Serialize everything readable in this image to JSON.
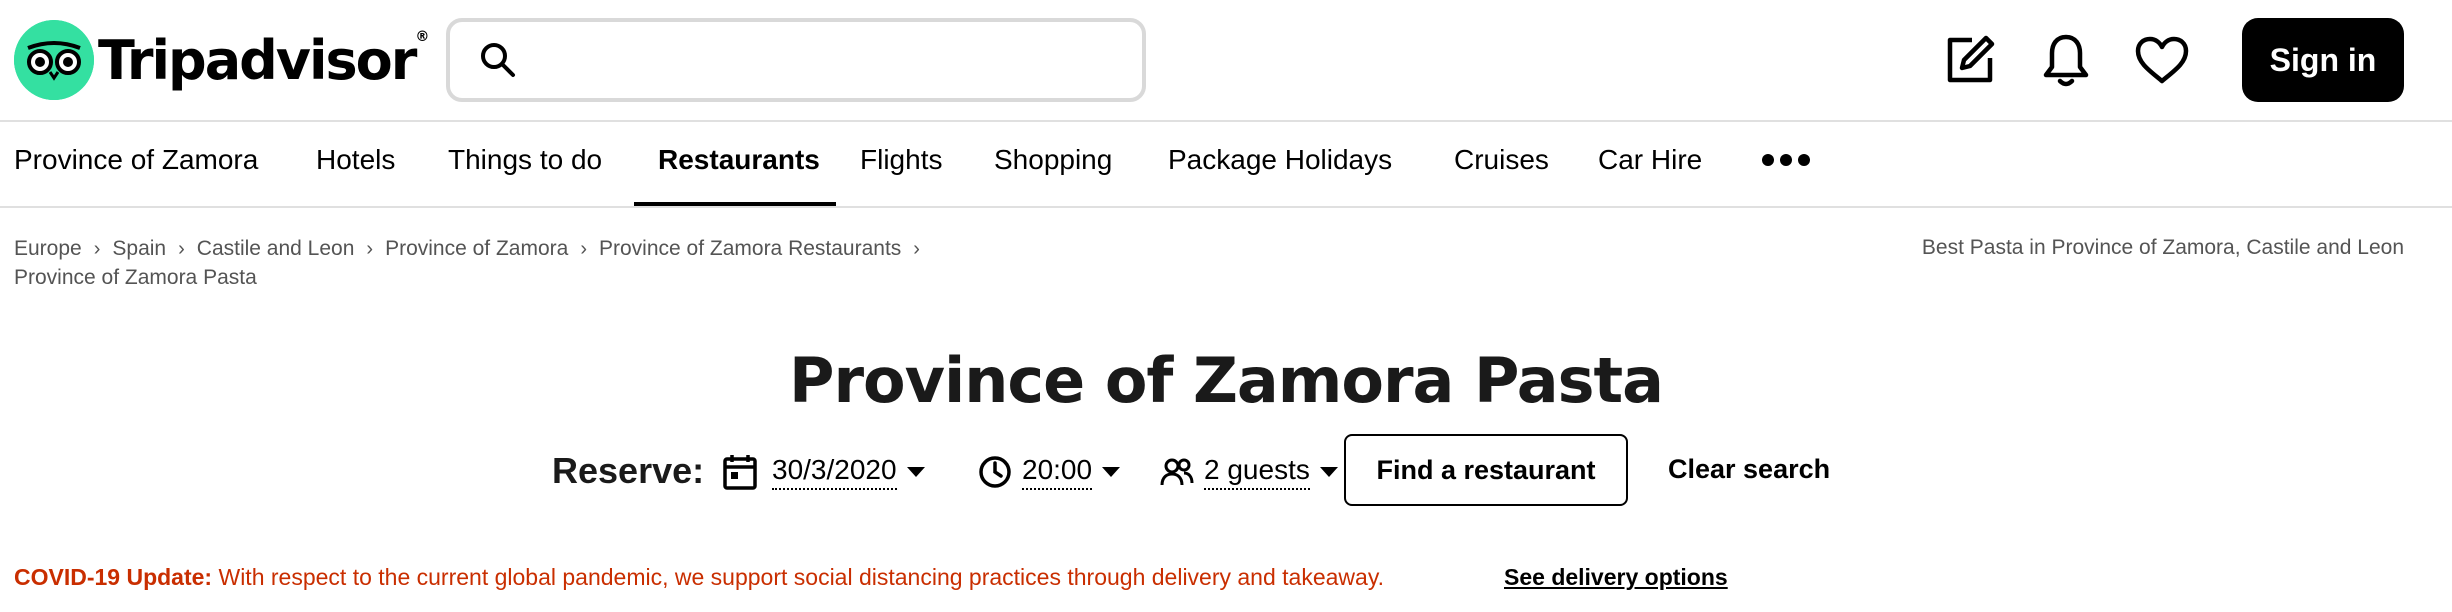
{
  "header": {
    "logo_text": "Tripadvisor",
    "logo_tm": "®",
    "search_value": "",
    "sign_in_label": "Sign in",
    "brand_color": "#34e0a1"
  },
  "nav": {
    "items": [
      {
        "label": "Province of Zamora"
      },
      {
        "label": "Hotels"
      },
      {
        "label": "Things to do"
      },
      {
        "label": "Restaurants",
        "active": true
      },
      {
        "label": "Flights"
      },
      {
        "label": "Shopping"
      },
      {
        "label": "Package Holidays"
      },
      {
        "label": "Cruises"
      },
      {
        "label": "Car Hire"
      }
    ],
    "more_icon": "more-dots-icon"
  },
  "breadcrumb": {
    "items": [
      {
        "label": "Europe"
      },
      {
        "label": "Spain"
      },
      {
        "label": "Castile and Leon"
      },
      {
        "label": "Province of Zamora"
      },
      {
        "label": "Province of Zamora Restaurants"
      },
      {
        "label": "Province of Zamora Pasta"
      }
    ],
    "separator": "›",
    "related": "Best Pasta in Province of Zamora, Castile and Leon"
  },
  "page": {
    "title": "Province of Zamora Pasta"
  },
  "reserve": {
    "label": "Reserve:",
    "date": "30/3/2020",
    "time": "20:00",
    "guests": "2 guests",
    "find_button": "Find a restaurant",
    "clear_button": "Clear search"
  },
  "covid": {
    "prefix": "COVID-19 Update:",
    "message": " With respect to the current global pandemic, we support social distancing practices through delivery and takeaway.",
    "link": "See delivery options",
    "color": "#c92e00"
  }
}
